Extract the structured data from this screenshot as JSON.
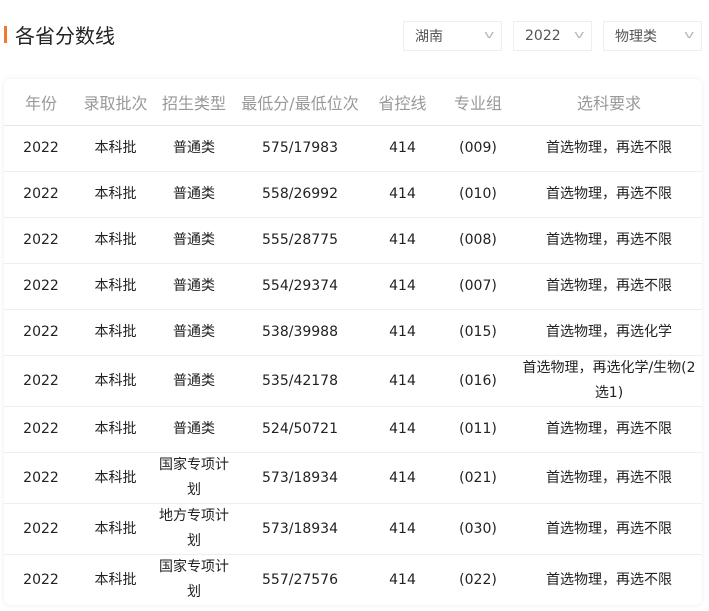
{
  "header": {
    "title": "各省分数线"
  },
  "filters": {
    "province": "湖南",
    "year": "2022",
    "subject": "物理类"
  },
  "table": {
    "columns": [
      "年份",
      "录取批次",
      "招生类型",
      "最低分/最低位次",
      "省控线",
      "专业组",
      "选科要求"
    ],
    "rows": [
      [
        "2022",
        "本科批",
        "普通类",
        "575/17983",
        "414",
        "(009)",
        "首选物理，再选不限"
      ],
      [
        "2022",
        "本科批",
        "普通类",
        "558/26992",
        "414",
        "(010)",
        "首选物理，再选不限"
      ],
      [
        "2022",
        "本科批",
        "普通类",
        "555/28775",
        "414",
        "(008)",
        "首选物理，再选不限"
      ],
      [
        "2022",
        "本科批",
        "普通类",
        "554/29374",
        "414",
        "(007)",
        "首选物理，再选不限"
      ],
      [
        "2022",
        "本科批",
        "普通类",
        "538/39988",
        "414",
        "(015)",
        "首选物理，再选化学"
      ],
      [
        "2022",
        "本科批",
        "普通类",
        "535/42178",
        "414",
        "(016)",
        "首选物理，再选化学/生物(2选1)"
      ],
      [
        "2022",
        "本科批",
        "普通类",
        "524/50721",
        "414",
        "(011)",
        "首选物理，再选不限"
      ],
      [
        "2022",
        "本科批",
        "国家专项计划",
        "573/18934",
        "414",
        "(021)",
        "首选物理，再选不限"
      ],
      [
        "2022",
        "本科批",
        "地方专项计划",
        "573/18934",
        "414",
        "(030)",
        "首选物理，再选不限"
      ],
      [
        "2022",
        "本科批",
        "国家专项计划",
        "557/27576",
        "414",
        "(022)",
        "首选物理，再选不限"
      ]
    ]
  }
}
